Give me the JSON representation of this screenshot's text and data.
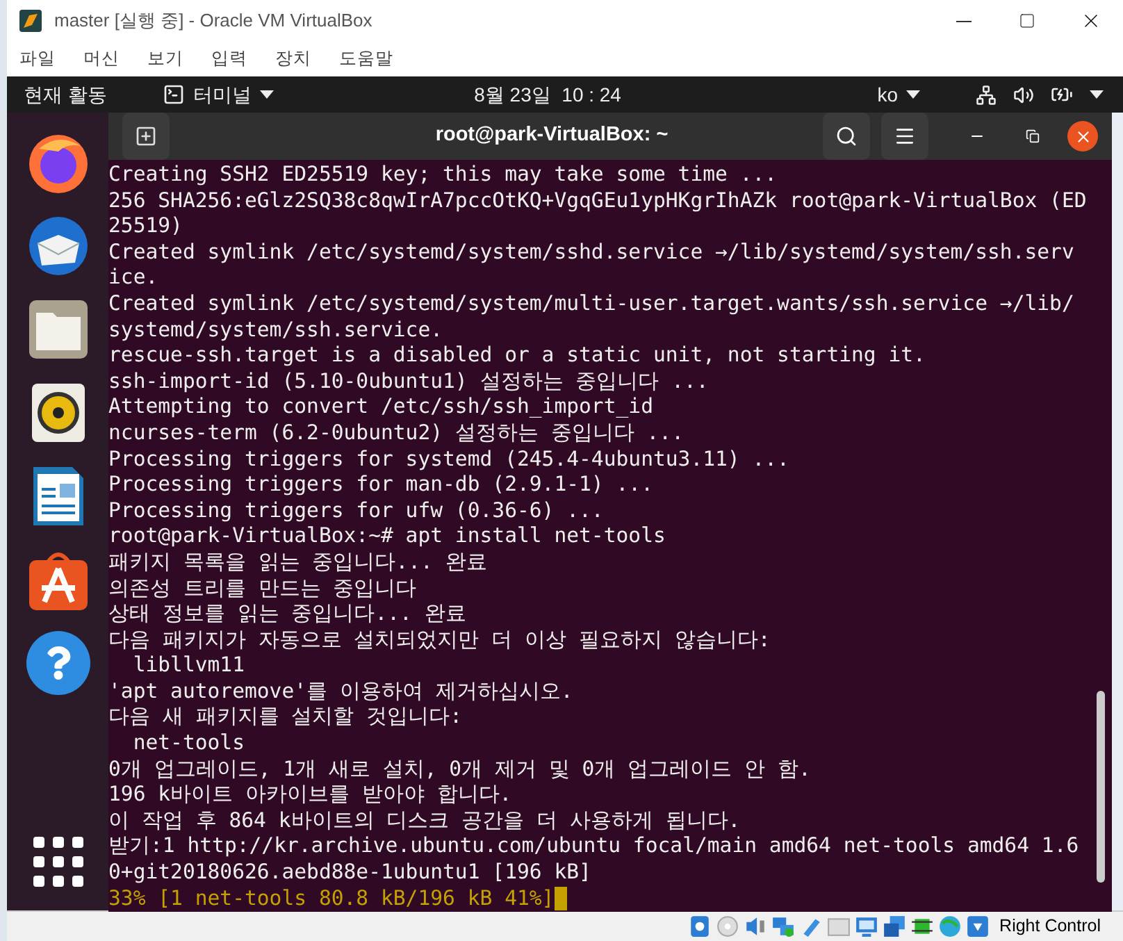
{
  "window": {
    "title": "master [실행 중] - Oracle VM VirtualBox"
  },
  "menu": [
    "파일",
    "머신",
    "보기",
    "입력",
    "장치",
    "도움말"
  ],
  "top_bar": {
    "activities": "현재 활동",
    "app": "터미널",
    "clock": "8월 23일  10 : 24",
    "input_method": "ko"
  },
  "terminal": {
    "title": "root@park-VirtualBox: ~",
    "lines": [
      {
        "kind": "output",
        "text": "Creating SSH2 ED25519 key; this may take some time ..."
      },
      {
        "kind": "output",
        "text": "256 SHA256:eGlz2SQ38c8qwIrA7pccOtKQ+VgqGEu1ypHKgrIhAZk root@park-VirtualBox (ED"
      },
      {
        "kind": "output",
        "text": "25519)"
      },
      {
        "kind": "output",
        "text": "Created symlink /etc/systemd/system/sshd.service →/lib/systemd/system/ssh.serv"
      },
      {
        "kind": "output",
        "text": "ice."
      },
      {
        "kind": "output",
        "text": "Created symlink /etc/systemd/system/multi-user.target.wants/ssh.service →/lib/"
      },
      {
        "kind": "output",
        "text": "systemd/system/ssh.service."
      },
      {
        "kind": "output",
        "text": "rescue-ssh.target is a disabled or a static unit, not starting it."
      },
      {
        "kind": "output",
        "text": "ssh-import-id (5.10-0ubuntu1) 설정하는 중입니다 ..."
      },
      {
        "kind": "output",
        "text": "Attempting to convert /etc/ssh/ssh_import_id"
      },
      {
        "kind": "output",
        "text": "ncurses-term (6.2-0ubuntu2) 설정하는 중입니다 ..."
      },
      {
        "kind": "output",
        "text": "Processing triggers for systemd (245.4-4ubuntu3.11) ..."
      },
      {
        "kind": "output",
        "text": "Processing triggers for man-db (2.9.1-1) ..."
      },
      {
        "kind": "output",
        "text": "Processing triggers for ufw (0.36-6) ..."
      },
      {
        "kind": "output",
        "text": "root@park-VirtualBox:~# apt install net-tools"
      },
      {
        "kind": "output",
        "text": "패키지 목록을 읽는 중입니다... 완료"
      },
      {
        "kind": "output",
        "text": "의존성 트리를 만드는 중입니다"
      },
      {
        "kind": "output",
        "text": "상태 정보를 읽는 중입니다... 완료"
      },
      {
        "kind": "output",
        "text": "다음 패키지가 자동으로 설치되었지만 더 이상 필요하지 않습니다:"
      },
      {
        "kind": "output",
        "text": "  libllvm11"
      },
      {
        "kind": "output",
        "text": "'apt autoremove'를 이용하여 제거하십시오."
      },
      {
        "kind": "output",
        "text": "다음 새 패키지를 설치할 것입니다:"
      },
      {
        "kind": "output",
        "text": "  net-tools"
      },
      {
        "kind": "output",
        "text": "0개 업그레이드, 1개 새로 설치, 0개 제거 및 0개 업그레이드 안 함."
      },
      {
        "kind": "output",
        "text": "196 k바이트 아카이브를 받아야 합니다."
      },
      {
        "kind": "output",
        "text": "이 작업 후 864 k바이트의 디스크 공간을 더 사용하게 됩니다."
      },
      {
        "kind": "output",
        "text": "받기:1 http://kr.archive.ubuntu.com/ubuntu focal/main amd64 net-tools amd64 1.6"
      },
      {
        "kind": "output",
        "text": "0+git20180626.aebd88e-1ubuntu1 [196 kB]"
      },
      {
        "kind": "progress",
        "text": "33% [1 net-tools 80.8 kB/196 kB 41%]"
      }
    ]
  },
  "status_bar": {
    "host_key": "Right Control"
  }
}
